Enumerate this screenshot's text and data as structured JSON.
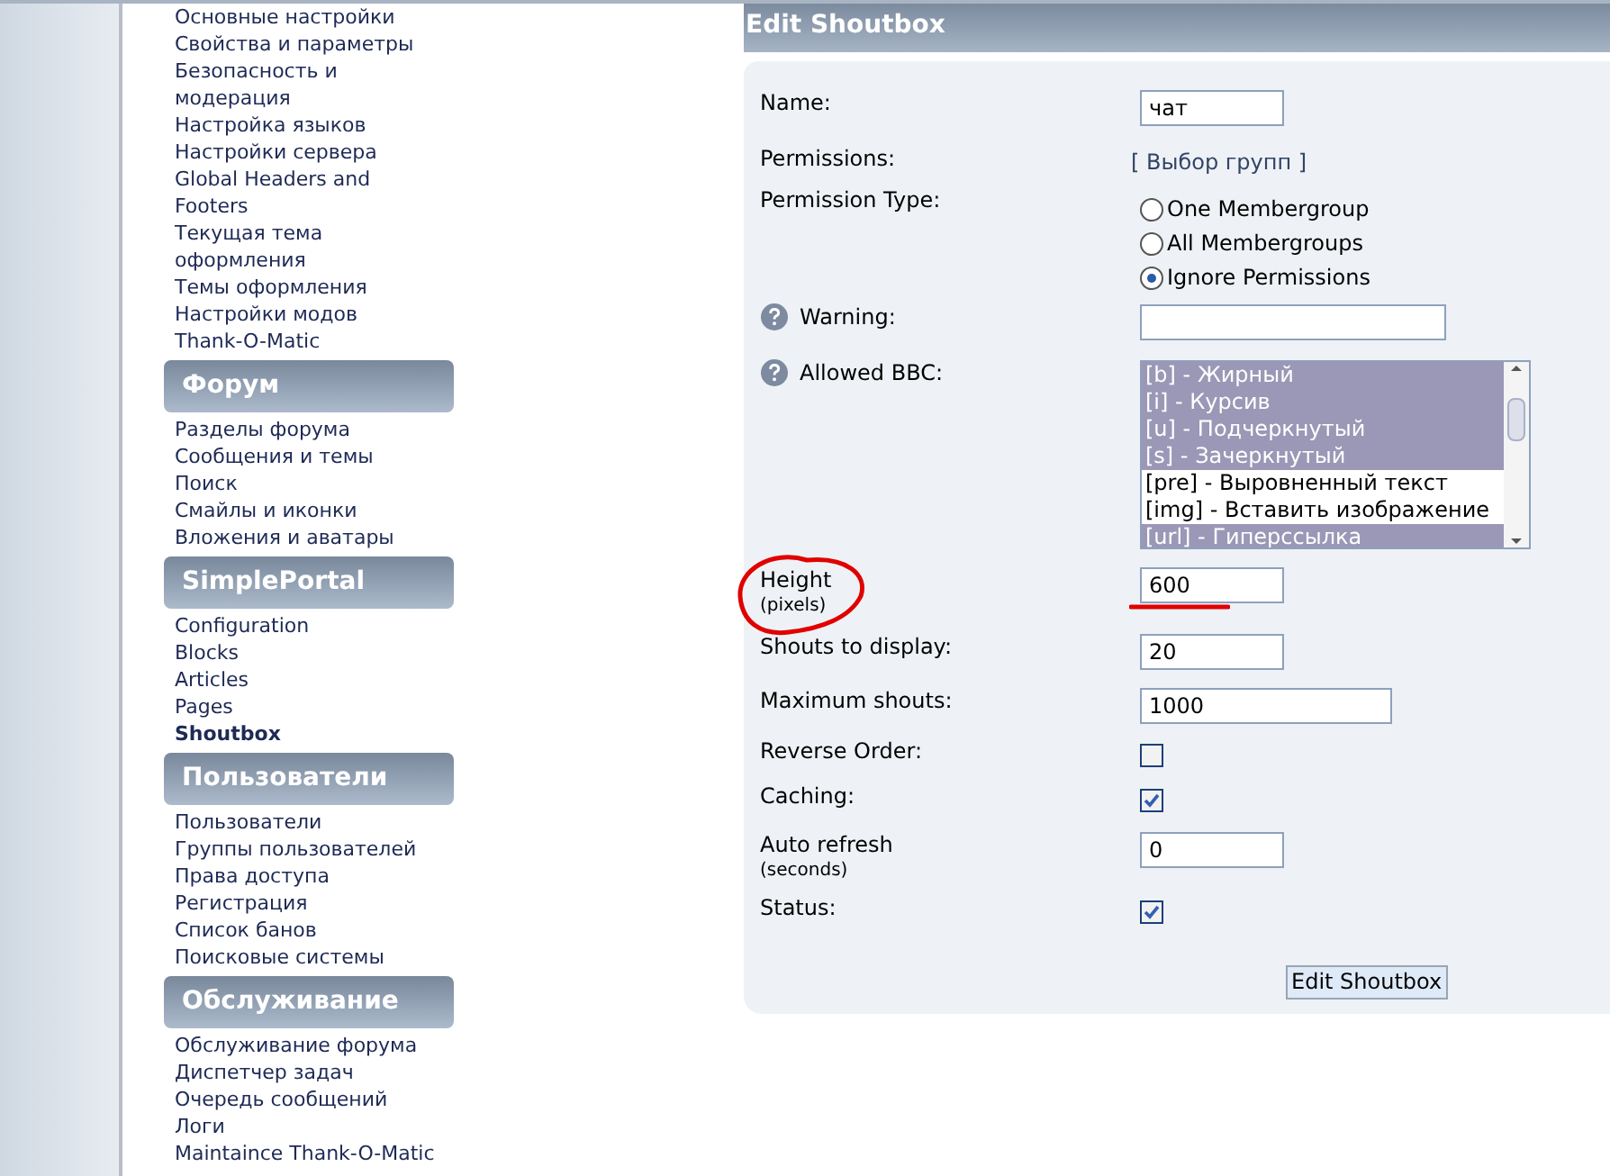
{
  "sidebar": {
    "top_items": [
      {
        "label": "Основные настройки",
        "current": false
      },
      {
        "label": "Свойства и параметры",
        "current": false
      },
      {
        "label": "Безопасность и модерация",
        "current": false
      },
      {
        "label": "Настройка языков",
        "current": false
      },
      {
        "label": "Настройки сервера",
        "current": false
      },
      {
        "label": "Global Headers and Footers",
        "current": false
      },
      {
        "label": "Текущая тема оформления",
        "current": false
      },
      {
        "label": "Темы оформления",
        "current": false
      },
      {
        "label": "Настройки модов",
        "current": false
      },
      {
        "label": "Thank-O-Matic",
        "current": false
      }
    ],
    "sections": [
      {
        "title": "Форум",
        "items": [
          {
            "label": "Разделы форума",
            "current": false
          },
          {
            "label": "Сообщения и темы",
            "current": false
          },
          {
            "label": "Поиск",
            "current": false
          },
          {
            "label": "Смайлы и иконки",
            "current": false
          },
          {
            "label": "Вложения и аватары",
            "current": false
          }
        ]
      },
      {
        "title": "SimplePortal",
        "items": [
          {
            "label": "Configuration",
            "current": false
          },
          {
            "label": "Blocks",
            "current": false
          },
          {
            "label": "Articles",
            "current": false
          },
          {
            "label": "Pages",
            "current": false
          },
          {
            "label": "Shoutbox",
            "current": true
          }
        ]
      },
      {
        "title": "Пользователи",
        "items": [
          {
            "label": "Пользователи",
            "current": false
          },
          {
            "label": "Группы пользователей",
            "current": false
          },
          {
            "label": "Права доступа",
            "current": false
          },
          {
            "label": "Регистрация",
            "current": false
          },
          {
            "label": "Список банов",
            "current": false
          },
          {
            "label": "Поисковые системы",
            "current": false
          }
        ]
      },
      {
        "title": "Обслуживание",
        "items": [
          {
            "label": "Обслуживание форума",
            "current": false
          },
          {
            "label": "Диспетчер задач",
            "current": false
          },
          {
            "label": "Очередь сообщений",
            "current": false
          },
          {
            "label": "Логи",
            "current": false
          },
          {
            "label": "Maintaince Thank-O-Matic",
            "current": false
          }
        ]
      }
    ]
  },
  "form": {
    "title": "Edit Shoutbox",
    "fields": [
      {
        "kind": "text",
        "label": "Name:",
        "value": "чат",
        "help": false
      },
      {
        "kind": "link",
        "label": "Permissions:",
        "link": "[ Выбор групп ]",
        "help": false
      },
      {
        "kind": "radio",
        "label": "Permission Type:",
        "help": false,
        "options": [
          {
            "label": "One Membergroup",
            "selected": false
          },
          {
            "label": "All Membergroups",
            "selected": false
          },
          {
            "label": "Ignore Permissions",
            "selected": true
          }
        ]
      },
      {
        "kind": "text",
        "label": "Warning:",
        "help": true
      },
      {
        "kind": "listbox",
        "label": "Allowed BBC:",
        "help": true,
        "options": [
          {
            "label": "[b] - Жирный",
            "selected": true
          },
          {
            "label": "[i] - Курсив",
            "selected": true
          },
          {
            "label": "[u] - Подчеркнутый",
            "selected": true
          },
          {
            "label": "[s] - Зачеркнутый",
            "selected": true
          },
          {
            "label": "[pre] - Выровненный текст",
            "selected": false
          },
          {
            "label": "[img] - Вставить изображение",
            "selected": false
          },
          {
            "label": "[url] - Гиперссылка",
            "selected": true
          }
        ]
      },
      {
        "kind": "text",
        "label": "Height",
        "sublabel": "(pixels)",
        "value": "600",
        "help": false,
        "annotated": true
      },
      {
        "kind": "text",
        "label": "Shouts to display:",
        "value": "20",
        "help": false
      },
      {
        "kind": "text",
        "label": "Maximum shouts:",
        "value": "1000",
        "help": false
      },
      {
        "kind": "checkbox",
        "label": "Reverse Order:",
        "checked": false,
        "help": false
      },
      {
        "kind": "checkbox",
        "label": "Caching:",
        "checked": true,
        "help": false
      },
      {
        "kind": "text",
        "label": "Auto refresh",
        "sublabel": "(seconds)",
        "value": "0",
        "help": false
      },
      {
        "kind": "checkbox",
        "label": "Status:",
        "checked": true,
        "help": false
      }
    ],
    "submit": "Edit Shoutbox"
  }
}
